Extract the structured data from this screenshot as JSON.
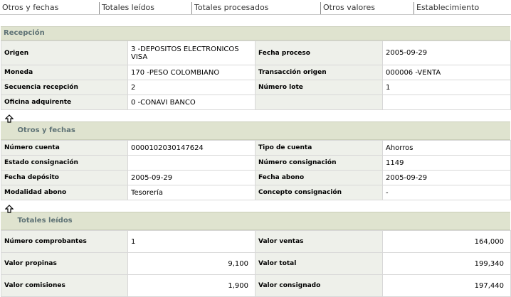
{
  "tabs": [
    "Otros y fechas",
    "Totales leídos",
    "Totales procesados",
    "Otros valores",
    "Establecimiento"
  ],
  "recepcion": {
    "title": "Recepción",
    "rows": [
      {
        "l1": "Origen",
        "v1": "3 -DEPOSITOS ELECTRONICOS VISA",
        "l2": "Fecha proceso",
        "v2": "2005-09-29"
      },
      {
        "l1": "Moneda",
        "v1": "170 -PESO COLOMBIANO",
        "l2": "Transacción origen",
        "v2": "000006 -VENTA"
      },
      {
        "l1": "Secuencia recepción",
        "v1": "2",
        "l2": "Número lote",
        "v2": "1"
      },
      {
        "l1": "Oficina adquirente",
        "v1": "0 -CONAVI BANCO",
        "l2": "",
        "v2": ""
      }
    ]
  },
  "otros": {
    "title": "Otros y fechas",
    "rows": [
      {
        "l1": "Número cuenta",
        "v1": "0000102030147624",
        "l2": "Tipo de cuenta",
        "v2": "Ahorros"
      },
      {
        "l1": "Estado consignación",
        "v1": "",
        "l2": "Número consignación",
        "v2": "1149"
      },
      {
        "l1": "Fecha depósito",
        "v1": "2005-09-29",
        "l2": "Fecha abono",
        "v2": "2005-09-29"
      },
      {
        "l1": "Modalidad abono",
        "v1": "Tesorería",
        "l2": "Concepto consignación",
        "v2": "-"
      }
    ]
  },
  "totales": {
    "title": "Totales leídos",
    "rows": [
      {
        "l1": "Número comprobantes",
        "v1": "1",
        "l2": "Valor ventas",
        "v2": "164,000"
      },
      {
        "l1": "Valor propinas",
        "v1": "9,100",
        "l2": "Valor total",
        "v2": "199,340"
      },
      {
        "l1": "Valor comisiones",
        "v1": "1,900",
        "l2": "Valor consignado",
        "v2": "197,440"
      }
    ]
  }
}
